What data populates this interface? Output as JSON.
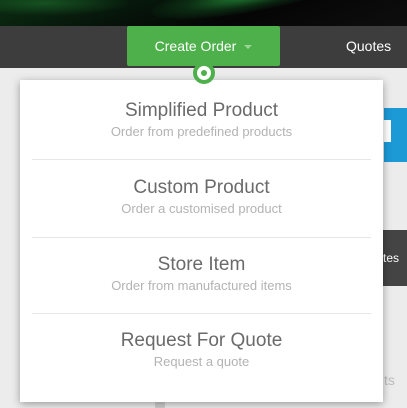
{
  "nav": {
    "create_order_label": "Create Order",
    "quotes_label": "Quotes"
  },
  "background": {
    "partial_button_text": "tes",
    "partial_text": "ts"
  },
  "menu": {
    "items": [
      {
        "title": "Simplified Product",
        "subtitle": "Order from predefined products"
      },
      {
        "title": "Custom Product",
        "subtitle": "Order a customised product"
      },
      {
        "title": "Store Item",
        "subtitle": "Order from manufactured items"
      },
      {
        "title": "Request For Quote",
        "subtitle": "Request a quote"
      }
    ]
  },
  "colors": {
    "accent_green": "#4db04a",
    "nav_dark": "#3d3d3d",
    "accent_blue": "#1c9ad6"
  }
}
